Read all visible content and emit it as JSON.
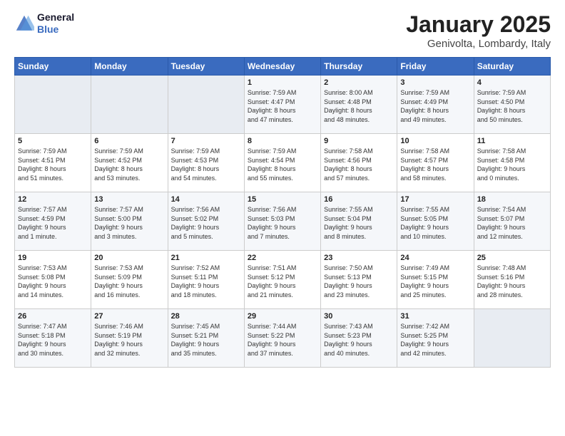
{
  "logo": {
    "line1": "General",
    "line2": "Blue"
  },
  "title": "January 2025",
  "subtitle": "Genivolta, Lombardy, Italy",
  "headers": [
    "Sunday",
    "Monday",
    "Tuesday",
    "Wednesday",
    "Thursday",
    "Friday",
    "Saturday"
  ],
  "weeks": [
    [
      {
        "num": "",
        "info": ""
      },
      {
        "num": "",
        "info": ""
      },
      {
        "num": "",
        "info": ""
      },
      {
        "num": "1",
        "info": "Sunrise: 7:59 AM\nSunset: 4:47 PM\nDaylight: 8 hours\nand 47 minutes."
      },
      {
        "num": "2",
        "info": "Sunrise: 8:00 AM\nSunset: 4:48 PM\nDaylight: 8 hours\nand 48 minutes."
      },
      {
        "num": "3",
        "info": "Sunrise: 7:59 AM\nSunset: 4:49 PM\nDaylight: 8 hours\nand 49 minutes."
      },
      {
        "num": "4",
        "info": "Sunrise: 7:59 AM\nSunset: 4:50 PM\nDaylight: 8 hours\nand 50 minutes."
      }
    ],
    [
      {
        "num": "5",
        "info": "Sunrise: 7:59 AM\nSunset: 4:51 PM\nDaylight: 8 hours\nand 51 minutes."
      },
      {
        "num": "6",
        "info": "Sunrise: 7:59 AM\nSunset: 4:52 PM\nDaylight: 8 hours\nand 53 minutes."
      },
      {
        "num": "7",
        "info": "Sunrise: 7:59 AM\nSunset: 4:53 PM\nDaylight: 8 hours\nand 54 minutes."
      },
      {
        "num": "8",
        "info": "Sunrise: 7:59 AM\nSunset: 4:54 PM\nDaylight: 8 hours\nand 55 minutes."
      },
      {
        "num": "9",
        "info": "Sunrise: 7:58 AM\nSunset: 4:56 PM\nDaylight: 8 hours\nand 57 minutes."
      },
      {
        "num": "10",
        "info": "Sunrise: 7:58 AM\nSunset: 4:57 PM\nDaylight: 8 hours\nand 58 minutes."
      },
      {
        "num": "11",
        "info": "Sunrise: 7:58 AM\nSunset: 4:58 PM\nDaylight: 9 hours\nand 0 minutes."
      }
    ],
    [
      {
        "num": "12",
        "info": "Sunrise: 7:57 AM\nSunset: 4:59 PM\nDaylight: 9 hours\nand 1 minute."
      },
      {
        "num": "13",
        "info": "Sunrise: 7:57 AM\nSunset: 5:00 PM\nDaylight: 9 hours\nand 3 minutes."
      },
      {
        "num": "14",
        "info": "Sunrise: 7:56 AM\nSunset: 5:02 PM\nDaylight: 9 hours\nand 5 minutes."
      },
      {
        "num": "15",
        "info": "Sunrise: 7:56 AM\nSunset: 5:03 PM\nDaylight: 9 hours\nand 7 minutes."
      },
      {
        "num": "16",
        "info": "Sunrise: 7:55 AM\nSunset: 5:04 PM\nDaylight: 9 hours\nand 8 minutes."
      },
      {
        "num": "17",
        "info": "Sunrise: 7:55 AM\nSunset: 5:05 PM\nDaylight: 9 hours\nand 10 minutes."
      },
      {
        "num": "18",
        "info": "Sunrise: 7:54 AM\nSunset: 5:07 PM\nDaylight: 9 hours\nand 12 minutes."
      }
    ],
    [
      {
        "num": "19",
        "info": "Sunrise: 7:53 AM\nSunset: 5:08 PM\nDaylight: 9 hours\nand 14 minutes."
      },
      {
        "num": "20",
        "info": "Sunrise: 7:53 AM\nSunset: 5:09 PM\nDaylight: 9 hours\nand 16 minutes."
      },
      {
        "num": "21",
        "info": "Sunrise: 7:52 AM\nSunset: 5:11 PM\nDaylight: 9 hours\nand 18 minutes."
      },
      {
        "num": "22",
        "info": "Sunrise: 7:51 AM\nSunset: 5:12 PM\nDaylight: 9 hours\nand 21 minutes."
      },
      {
        "num": "23",
        "info": "Sunrise: 7:50 AM\nSunset: 5:13 PM\nDaylight: 9 hours\nand 23 minutes."
      },
      {
        "num": "24",
        "info": "Sunrise: 7:49 AM\nSunset: 5:15 PM\nDaylight: 9 hours\nand 25 minutes."
      },
      {
        "num": "25",
        "info": "Sunrise: 7:48 AM\nSunset: 5:16 PM\nDaylight: 9 hours\nand 28 minutes."
      }
    ],
    [
      {
        "num": "26",
        "info": "Sunrise: 7:47 AM\nSunset: 5:18 PM\nDaylight: 9 hours\nand 30 minutes."
      },
      {
        "num": "27",
        "info": "Sunrise: 7:46 AM\nSunset: 5:19 PM\nDaylight: 9 hours\nand 32 minutes."
      },
      {
        "num": "28",
        "info": "Sunrise: 7:45 AM\nSunset: 5:21 PM\nDaylight: 9 hours\nand 35 minutes."
      },
      {
        "num": "29",
        "info": "Sunrise: 7:44 AM\nSunset: 5:22 PM\nDaylight: 9 hours\nand 37 minutes."
      },
      {
        "num": "30",
        "info": "Sunrise: 7:43 AM\nSunset: 5:23 PM\nDaylight: 9 hours\nand 40 minutes."
      },
      {
        "num": "31",
        "info": "Sunrise: 7:42 AM\nSunset: 5:25 PM\nDaylight: 9 hours\nand 42 minutes."
      },
      {
        "num": "",
        "info": ""
      }
    ]
  ]
}
